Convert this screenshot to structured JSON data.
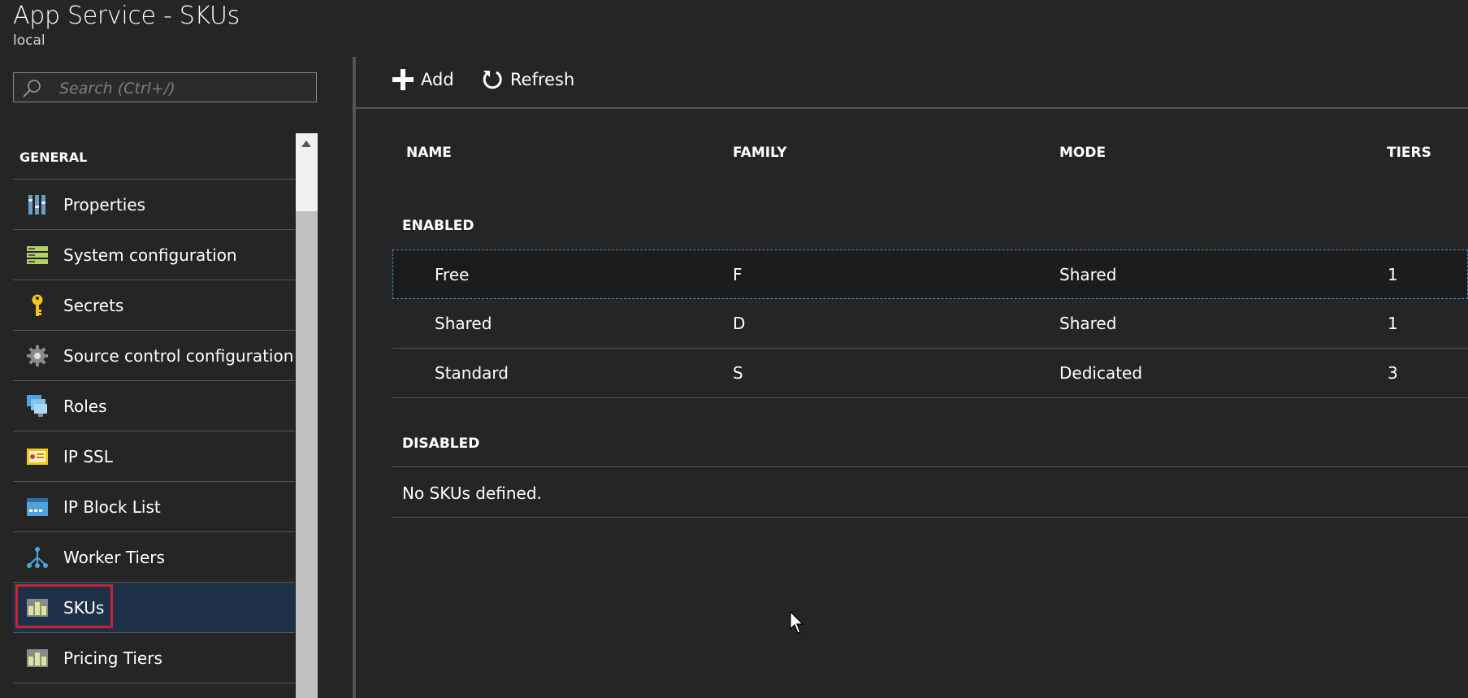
{
  "header": {
    "title": "App Service - SKUs",
    "subtitle": "local"
  },
  "search": {
    "placeholder": "Search (Ctrl+/)"
  },
  "nav": {
    "section_heading": "GENERAL",
    "items": [
      {
        "label": "Properties",
        "icon": "properties-icon"
      },
      {
        "label": "System configuration",
        "icon": "system-config-icon"
      },
      {
        "label": "Secrets",
        "icon": "key-icon"
      },
      {
        "label": "Source control configuration",
        "icon": "gear-icon"
      },
      {
        "label": "Roles",
        "icon": "roles-icon"
      },
      {
        "label": "IP SSL",
        "icon": "certificate-icon"
      },
      {
        "label": "IP Block List",
        "icon": "ip-block-icon"
      },
      {
        "label": "Worker Tiers",
        "icon": "worker-tiers-icon"
      },
      {
        "label": "SKUs",
        "icon": "skus-icon",
        "selected": true
      },
      {
        "label": "Pricing Tiers",
        "icon": "pricing-tiers-icon"
      }
    ]
  },
  "toolbar": {
    "add_label": "Add",
    "refresh_label": "Refresh"
  },
  "table": {
    "columns": [
      "NAME",
      "FAMILY",
      "MODE",
      "TIERS"
    ],
    "enabled_label": "ENABLED",
    "enabled_rows": [
      {
        "name": "Free",
        "family": "F",
        "mode": "Shared",
        "tiers": "1"
      },
      {
        "name": "Shared",
        "family": "D",
        "mode": "Shared",
        "tiers": "1"
      },
      {
        "name": "Standard",
        "family": "S",
        "mode": "Dedicated",
        "tiers": "3"
      }
    ],
    "disabled_label": "DISABLED",
    "disabled_empty": "No SKUs defined."
  },
  "colors": {
    "background": "#252526",
    "selected_nav": "#1f3148",
    "selection_outline": "#c4262e",
    "focus_border": "#3a8fd0"
  }
}
